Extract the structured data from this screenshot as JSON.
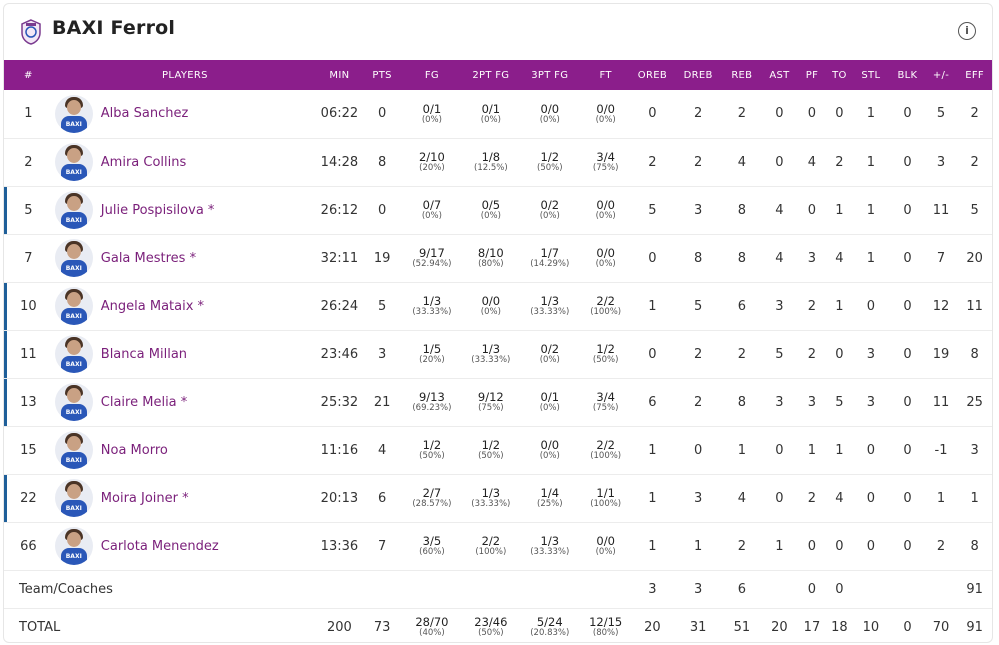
{
  "team": {
    "name": "BAXI Ferrol",
    "jersey_text": "BAXI",
    "accent": "#8b1e8b",
    "starter_color": "#1f5f99"
  },
  "columns": [
    "#",
    "PLAYERS",
    "MIN",
    "PTS",
    "FG",
    "2PT FG",
    "3PT FG",
    "FT",
    "OREB",
    "DREB",
    "REB",
    "AST",
    "PF",
    "TO",
    "STL",
    "BLK",
    "+/-",
    "EFF"
  ],
  "players": [
    {
      "num": "1",
      "name": "Alba Sanchez",
      "starter": false,
      "min": "06:22",
      "pts": "0",
      "fg": "0/1",
      "fg_pct": "(0%)",
      "fg2": "0/1",
      "fg2_pct": "(0%)",
      "fg3": "0/0",
      "fg3_pct": "(0%)",
      "ft": "0/0",
      "ft_pct": "(0%)",
      "oreb": "0",
      "dreb": "2",
      "reb": "2",
      "ast": "0",
      "pf": "0",
      "to": "0",
      "stl": "1",
      "blk": "0",
      "pm": "5",
      "eff": "2"
    },
    {
      "num": "2",
      "name": "Amira Collins",
      "starter": false,
      "min": "14:28",
      "pts": "8",
      "fg": "2/10",
      "fg_pct": "(20%)",
      "fg2": "1/8",
      "fg2_pct": "(12.5%)",
      "fg3": "1/2",
      "fg3_pct": "(50%)",
      "ft": "3/4",
      "ft_pct": "(75%)",
      "oreb": "2",
      "dreb": "2",
      "reb": "4",
      "ast": "0",
      "pf": "4",
      "to": "2",
      "stl": "1",
      "blk": "0",
      "pm": "3",
      "eff": "2"
    },
    {
      "num": "5",
      "name": "Julie Pospisilova *",
      "starter": true,
      "min": "26:12",
      "pts": "0",
      "fg": "0/7",
      "fg_pct": "(0%)",
      "fg2": "0/5",
      "fg2_pct": "(0%)",
      "fg3": "0/2",
      "fg3_pct": "(0%)",
      "ft": "0/0",
      "ft_pct": "(0%)",
      "oreb": "5",
      "dreb": "3",
      "reb": "8",
      "ast": "4",
      "pf": "0",
      "to": "1",
      "stl": "1",
      "blk": "0",
      "pm": "11",
      "eff": "5"
    },
    {
      "num": "7",
      "name": "Gala Mestres *",
      "starter": false,
      "min": "32:11",
      "pts": "19",
      "fg": "9/17",
      "fg_pct": "(52.94%)",
      "fg2": "8/10",
      "fg2_pct": "(80%)",
      "fg3": "1/7",
      "fg3_pct": "(14.29%)",
      "ft": "0/0",
      "ft_pct": "(0%)",
      "oreb": "0",
      "dreb": "8",
      "reb": "8",
      "ast": "4",
      "pf": "3",
      "to": "4",
      "stl": "1",
      "blk": "0",
      "pm": "7",
      "eff": "20"
    },
    {
      "num": "10",
      "name": "Angela Mataix *",
      "starter": true,
      "min": "26:24",
      "pts": "5",
      "fg": "1/3",
      "fg_pct": "(33.33%)",
      "fg2": "0/0",
      "fg2_pct": "(0%)",
      "fg3": "1/3",
      "fg3_pct": "(33.33%)",
      "ft": "2/2",
      "ft_pct": "(100%)",
      "oreb": "1",
      "dreb": "5",
      "reb": "6",
      "ast": "3",
      "pf": "2",
      "to": "1",
      "stl": "0",
      "blk": "0",
      "pm": "12",
      "eff": "11"
    },
    {
      "num": "11",
      "name": "Blanca Millan",
      "starter": true,
      "min": "23:46",
      "pts": "3",
      "fg": "1/5",
      "fg_pct": "(20%)",
      "fg2": "1/3",
      "fg2_pct": "(33.33%)",
      "fg3": "0/2",
      "fg3_pct": "(0%)",
      "ft": "1/2",
      "ft_pct": "(50%)",
      "oreb": "0",
      "dreb": "2",
      "reb": "2",
      "ast": "5",
      "pf": "2",
      "to": "0",
      "stl": "3",
      "blk": "0",
      "pm": "19",
      "eff": "8"
    },
    {
      "num": "13",
      "name": "Claire Melia *",
      "starter": true,
      "min": "25:32",
      "pts": "21",
      "fg": "9/13",
      "fg_pct": "(69.23%)",
      "fg2": "9/12",
      "fg2_pct": "(75%)",
      "fg3": "0/1",
      "fg3_pct": "(0%)",
      "ft": "3/4",
      "ft_pct": "(75%)",
      "oreb": "6",
      "dreb": "2",
      "reb": "8",
      "ast": "3",
      "pf": "3",
      "to": "5",
      "stl": "3",
      "blk": "0",
      "pm": "11",
      "eff": "25"
    },
    {
      "num": "15",
      "name": "Noa Morro",
      "starter": false,
      "min": "11:16",
      "pts": "4",
      "fg": "1/2",
      "fg_pct": "(50%)",
      "fg2": "1/2",
      "fg2_pct": "(50%)",
      "fg3": "0/0",
      "fg3_pct": "(0%)",
      "ft": "2/2",
      "ft_pct": "(100%)",
      "oreb": "1",
      "dreb": "0",
      "reb": "1",
      "ast": "0",
      "pf": "1",
      "to": "1",
      "stl": "0",
      "blk": "0",
      "pm": "-1",
      "eff": "3"
    },
    {
      "num": "22",
      "name": "Moira Joiner *",
      "starter": true,
      "min": "20:13",
      "pts": "6",
      "fg": "2/7",
      "fg_pct": "(28.57%)",
      "fg2": "1/3",
      "fg2_pct": "(33.33%)",
      "fg3": "1/4",
      "fg3_pct": "(25%)",
      "ft": "1/1",
      "ft_pct": "(100%)",
      "oreb": "1",
      "dreb": "3",
      "reb": "4",
      "ast": "0",
      "pf": "2",
      "to": "4",
      "stl": "0",
      "blk": "0",
      "pm": "1",
      "eff": "1"
    },
    {
      "num": "66",
      "name": "Carlota Menendez",
      "starter": false,
      "min": "13:36",
      "pts": "7",
      "fg": "3/5",
      "fg_pct": "(60%)",
      "fg2": "2/2",
      "fg2_pct": "(100%)",
      "fg3": "1/3",
      "fg3_pct": "(33.33%)",
      "ft": "0/0",
      "ft_pct": "(0%)",
      "oreb": "1",
      "dreb": "1",
      "reb": "2",
      "ast": "1",
      "pf": "0",
      "to": "0",
      "stl": "0",
      "blk": "0",
      "pm": "2",
      "eff": "8"
    }
  ],
  "team_row": {
    "label": "Team/Coaches",
    "oreb": "3",
    "dreb": "3",
    "reb": "6",
    "pf": "0",
    "to": "0",
    "eff": "91"
  },
  "total_row": {
    "label": "TOTAL",
    "min": "200",
    "pts": "73",
    "fg": "28/70",
    "fg_pct": "(40%)",
    "fg2": "23/46",
    "fg2_pct": "(50%)",
    "fg3": "5/24",
    "fg3_pct": "(20.83%)",
    "ft": "12/15",
    "ft_pct": "(80%)",
    "oreb": "20",
    "dreb": "31",
    "reb": "51",
    "ast": "20",
    "pf": "17",
    "to": "18",
    "stl": "10",
    "blk": "0",
    "pm": "70",
    "eff": "91"
  }
}
